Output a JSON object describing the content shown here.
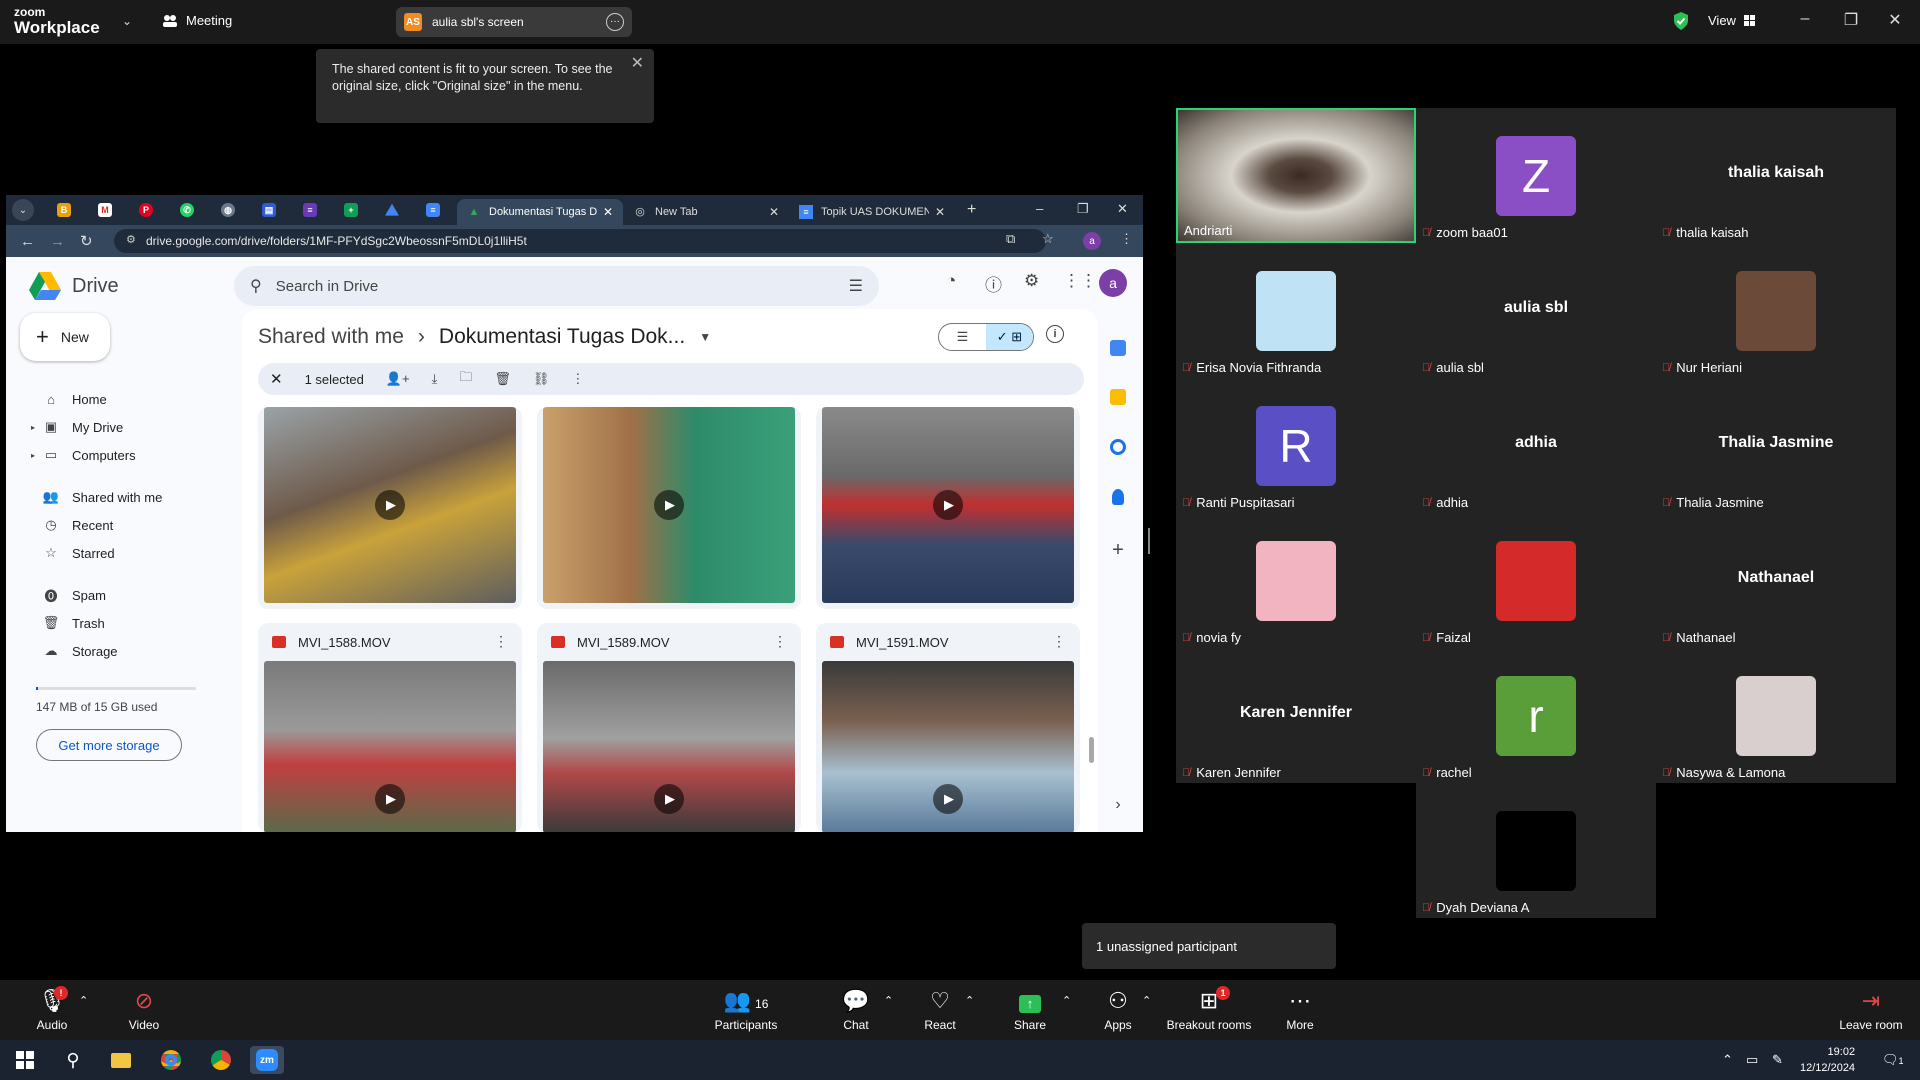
{
  "zoom": {
    "brand_top": "zoom",
    "brand_bottom": "Workplace",
    "meeting_label": "Meeting",
    "share_badge": "AS",
    "share_label": "aulia sbl's screen",
    "view_label": "View",
    "tooltip": "The shared content is fit to your screen. To see the original size, click \"Original size\" in the menu."
  },
  "chrome": {
    "tabs": [
      {
        "title": "Dokumentasi Tugas D...",
        "active": true
      },
      {
        "title": "New Tab",
        "active": false
      },
      {
        "title": "Topik UAS DOKUMEN",
        "active": false
      }
    ],
    "url": "drive.google.com/drive/folders/1MF-PFYdSgc2WbeossnF5mDL0j1lliH5t",
    "profile_initial": "a"
  },
  "drive": {
    "logo_text": "Drive",
    "search_placeholder": "Search in Drive",
    "new_label": "New",
    "avatar_initial": "a",
    "nav": [
      {
        "label": "Home",
        "icon": "home-icon"
      },
      {
        "label": "My Drive",
        "icon": "my-drive-icon"
      },
      {
        "label": "Computers",
        "icon": "computers-icon"
      },
      {
        "label": "Shared with me",
        "icon": "shared-icon"
      },
      {
        "label": "Recent",
        "icon": "clock-icon"
      },
      {
        "label": "Starred",
        "icon": "star-icon"
      },
      {
        "label": "Spam",
        "icon": "spam-icon"
      },
      {
        "label": "Trash",
        "icon": "trash-icon"
      },
      {
        "label": "Storage",
        "icon": "cloud-icon"
      }
    ],
    "storage_text": "147 MB of 15 GB used",
    "storage_fraction": 0.0098,
    "get_more_storage": "Get more storage",
    "breadcrumb_parent": "Shared with me",
    "breadcrumb_current": "Dokumentasi Tugas Dok...",
    "selected_text": "1 selected",
    "files": [
      {
        "name": "MVI_1588.MOV"
      },
      {
        "name": "MVI_1589.MOV"
      },
      {
        "name": "MVI_1591.MOV"
      }
    ]
  },
  "participants": [
    {
      "name": "Andriarti",
      "display": "video",
      "muted": false
    },
    {
      "name": "zoom baa01",
      "display": "avatar",
      "initial": "Z",
      "color": "#8a4fc4",
      "muted": true
    },
    {
      "name": "thalia kaisah",
      "display": "text",
      "big": "thalia kaisah",
      "muted": true
    },
    {
      "name": "Erisa Novia Fithranda",
      "display": "picture",
      "color": "#bfe3f5",
      "muted": true
    },
    {
      "name": "aulia sbl",
      "display": "text",
      "big": "aulia sbl",
      "muted": true
    },
    {
      "name": "Nur Heriani",
      "display": "picture",
      "color": "#6b4a3a",
      "muted": true
    },
    {
      "name": "Ranti Puspitasari",
      "display": "avatar",
      "initial": "R",
      "color": "#5a4fc4",
      "muted": true
    },
    {
      "name": "adhia",
      "display": "text",
      "big": "adhia",
      "muted": true
    },
    {
      "name": "Thalia Jasmine",
      "display": "text",
      "big": "Thalia Jasmine",
      "muted": true
    },
    {
      "name": "novia fy",
      "display": "picture",
      "color": "#f2b4c0",
      "muted": true
    },
    {
      "name": "Faizal",
      "display": "picture",
      "color": "#d42a2a",
      "muted": true
    },
    {
      "name": "Nathanael",
      "display": "text",
      "big": "Nathanael",
      "muted": true
    },
    {
      "name": "Karen Jennifer",
      "display": "text",
      "big": "Karen Jennifer",
      "muted": true
    },
    {
      "name": "rachel",
      "display": "avatar",
      "initial": "r",
      "color": "#5a9e3a",
      "muted": true
    },
    {
      "name": "Nasywa & Lamona",
      "display": "picture",
      "color": "#d9cfcf",
      "muted": true
    },
    {
      "name": "Dyah Deviana A",
      "display": "picture",
      "color": "#000000",
      "muted": true
    }
  ],
  "unassigned": "1 unassigned participant",
  "toolbar": {
    "audio": "Audio",
    "video": "Video",
    "participants": "Participants",
    "participants_count": "16",
    "chat": "Chat",
    "react": "React",
    "share": "Share",
    "apps": "Apps",
    "breakout": "Breakout rooms",
    "breakout_badge": "1",
    "more": "More",
    "leave": "Leave room"
  },
  "taskbar": {
    "time": "19:02",
    "date": "12/12/2024",
    "notif_count": "1"
  }
}
